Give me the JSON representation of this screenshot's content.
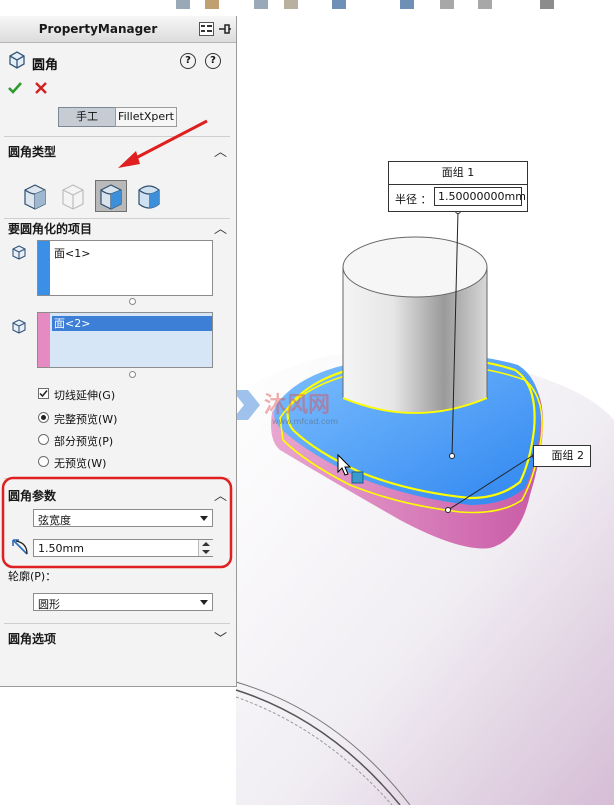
{
  "panel": {
    "title": "PropertyManager",
    "feature_title": "圆角",
    "help_icon": "help-icon",
    "mode_tabs": [
      "手工",
      "FilletXpert"
    ],
    "sections": {
      "fillet_type": "圆角类型",
      "items_to_fillet": "要圆角化的项目",
      "fillet_params": "圆角参数",
      "fillet_options": "圆角选项"
    },
    "list1": {
      "item": "面<1>"
    },
    "list2": {
      "item": "面<2>"
    },
    "options": {
      "tangent_propagation": "切线延伸(G)",
      "full_preview": "完整预览(W)",
      "partial_preview": "部分预览(P)",
      "no_preview": "无预览(W)"
    },
    "params": {
      "method": "弦宽度",
      "value": "1.50mm",
      "profile_label": "轮廓(P)：",
      "profile": "圆形"
    }
  },
  "callouts": {
    "face_group1": {
      "title": "面组 1",
      "radius_label": "半径 ：",
      "radius_value": "1.50000000mm"
    },
    "face_group2": {
      "title": "面组 2"
    }
  },
  "colors": {
    "accent_blue": "#4aa3ff",
    "face_pink": "#e98ac6",
    "highlight_yellow": "#ffff00",
    "annotation_red": "#e02020"
  }
}
